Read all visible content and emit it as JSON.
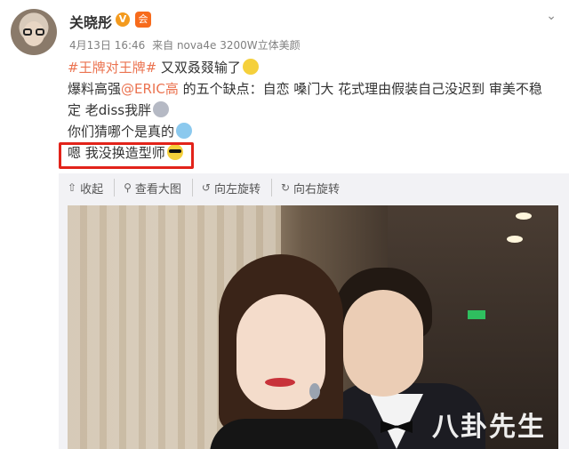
{
  "post": {
    "author": "关晓彤",
    "verified_badge": "V",
    "member_badge": "会",
    "date": "4月13日 16:46",
    "source": "来自 nova4e 3200W立体美颜",
    "content": {
      "line1_tag": "#王牌对王牌#",
      "line1_text": " 又双叒叕输了",
      "line2_prefix": "爆料高强",
      "line2_mention": "@ERIC高",
      "line2_text": " 的五个缺点：自恋 嗓门大 花式理由假装自己没迟到 审美不稳",
      "line3_text": "定 老diss我胖",
      "line4_text": "你们猜哪个是真的",
      "line5_text": "嗯 我没换造型师"
    }
  },
  "toolbar": {
    "collapse": "收起",
    "view_large": "查看大图",
    "rotate_left": "向左旋转",
    "rotate_right": "向右旋转"
  },
  "watermark": "八卦先生",
  "colors": {
    "link": "#eb7350",
    "highlight_border": "#e2231a"
  }
}
